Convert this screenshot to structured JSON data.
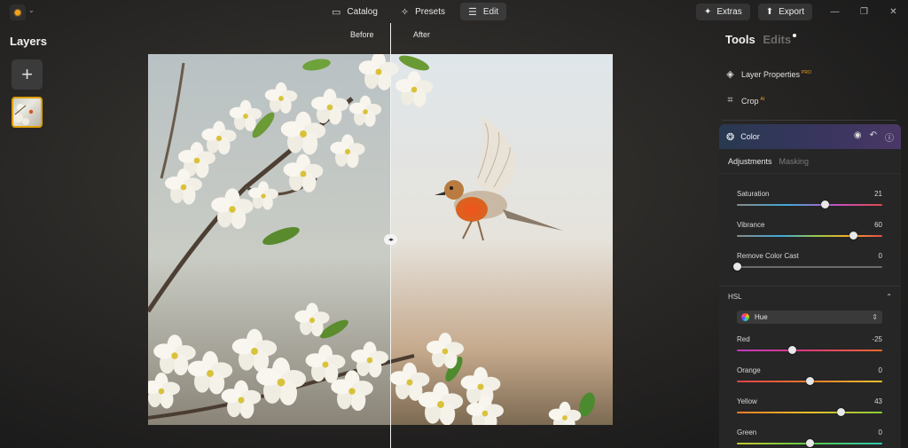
{
  "app": {
    "logo_icon": "sun-logo-icon",
    "modes": [
      {
        "label": "Catalog",
        "icon": "catalog-icon",
        "active": false
      },
      {
        "label": "Presets",
        "icon": "presets-icon",
        "active": false
      },
      {
        "label": "Edit",
        "icon": "sliders-icon",
        "active": true
      }
    ],
    "extras_label": "Extras",
    "export_label": "Export"
  },
  "left": {
    "title": "Layers",
    "add_icon": "plus-icon"
  },
  "compare": {
    "before_label": "Before",
    "after_label": "After"
  },
  "right": {
    "tools_tab": "Tools",
    "edits_tab": "Edits",
    "tools": [
      {
        "label": "Layer Properties",
        "badge": "PRO",
        "icon": "layers-icon"
      },
      {
        "label": "Crop",
        "badge": "AI",
        "icon": "crop-icon"
      }
    ],
    "color_panel": {
      "title": "Color",
      "tabs": {
        "active": "Adjustments",
        "inactive": "Masking"
      },
      "sliders": [
        {
          "label": "Saturation",
          "value": "21",
          "fraction": 0.605
        },
        {
          "label": "Vibrance",
          "value": "60",
          "fraction": 0.8
        },
        {
          "label": "Remove Color Cast",
          "value": "0",
          "fraction": 0.0
        }
      ],
      "hsl": {
        "title": "HSL",
        "mode": "Hue",
        "sliders": [
          {
            "label": "Red",
            "value": "-25",
            "fraction": 0.375
          },
          {
            "label": "Orange",
            "value": "0",
            "fraction": 0.5
          },
          {
            "label": "Yellow",
            "value": "43",
            "fraction": 0.715
          },
          {
            "label": "Green",
            "value": "0",
            "fraction": 0.5
          }
        ]
      }
    }
  },
  "colors": {
    "accent": "#f0a21f",
    "panel_header": "#3a3560"
  }
}
